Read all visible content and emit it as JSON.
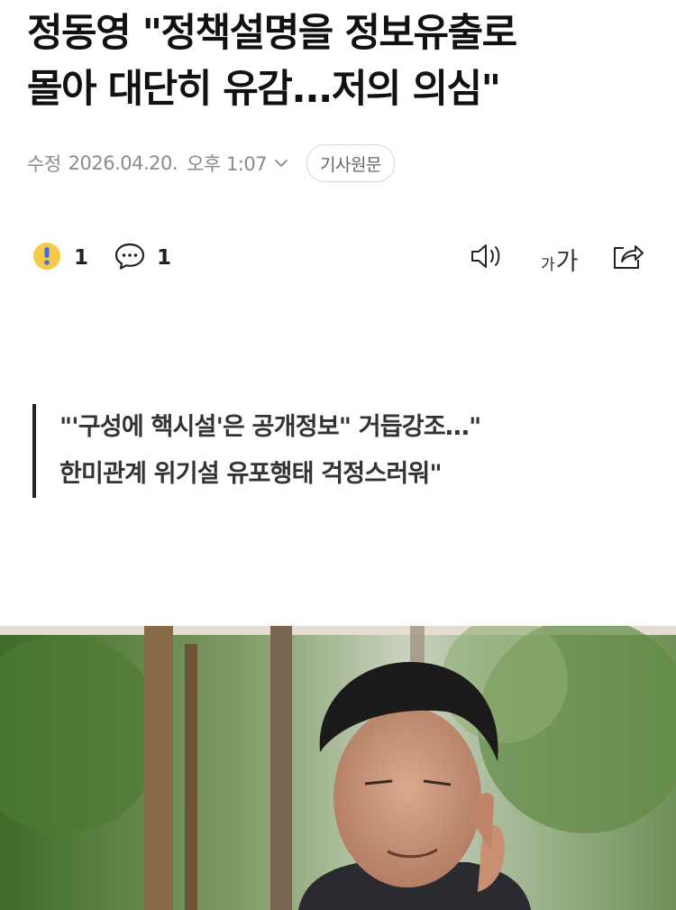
{
  "article": {
    "headline_line1": "정동영 \"정책설명을 정보유출로",
    "headline_line2": "몰아 대단히 유감...저의 의심\"",
    "meta": {
      "prefix": "수정",
      "date": "2026.04.20.",
      "time": "오후 1:07"
    },
    "source_button": "기사원문",
    "reactions": {
      "emotion_count": "1",
      "comment_count": "1"
    },
    "tools": {
      "fontsize_small": "가",
      "fontsize_large": "가"
    },
    "subtitle": {
      "line1": "\"'구성에 핵시설'은 공개정보\" 거듭강조…\"",
      "line2": "한미관계 위기설 유포행태 걱정스러워\""
    }
  },
  "icons": {
    "chevron": "chevron-down-icon",
    "emotion": "surprise-emoji-icon",
    "comment": "comment-icon",
    "audio": "speaker-icon",
    "share": "share-icon"
  },
  "colors": {
    "text_primary": "#111111",
    "text_meta": "#8a8a8a",
    "pill_border": "#d8d8d8",
    "emoji_yellow": "#f7c948",
    "emoji_mark": "#3b6ee8"
  }
}
